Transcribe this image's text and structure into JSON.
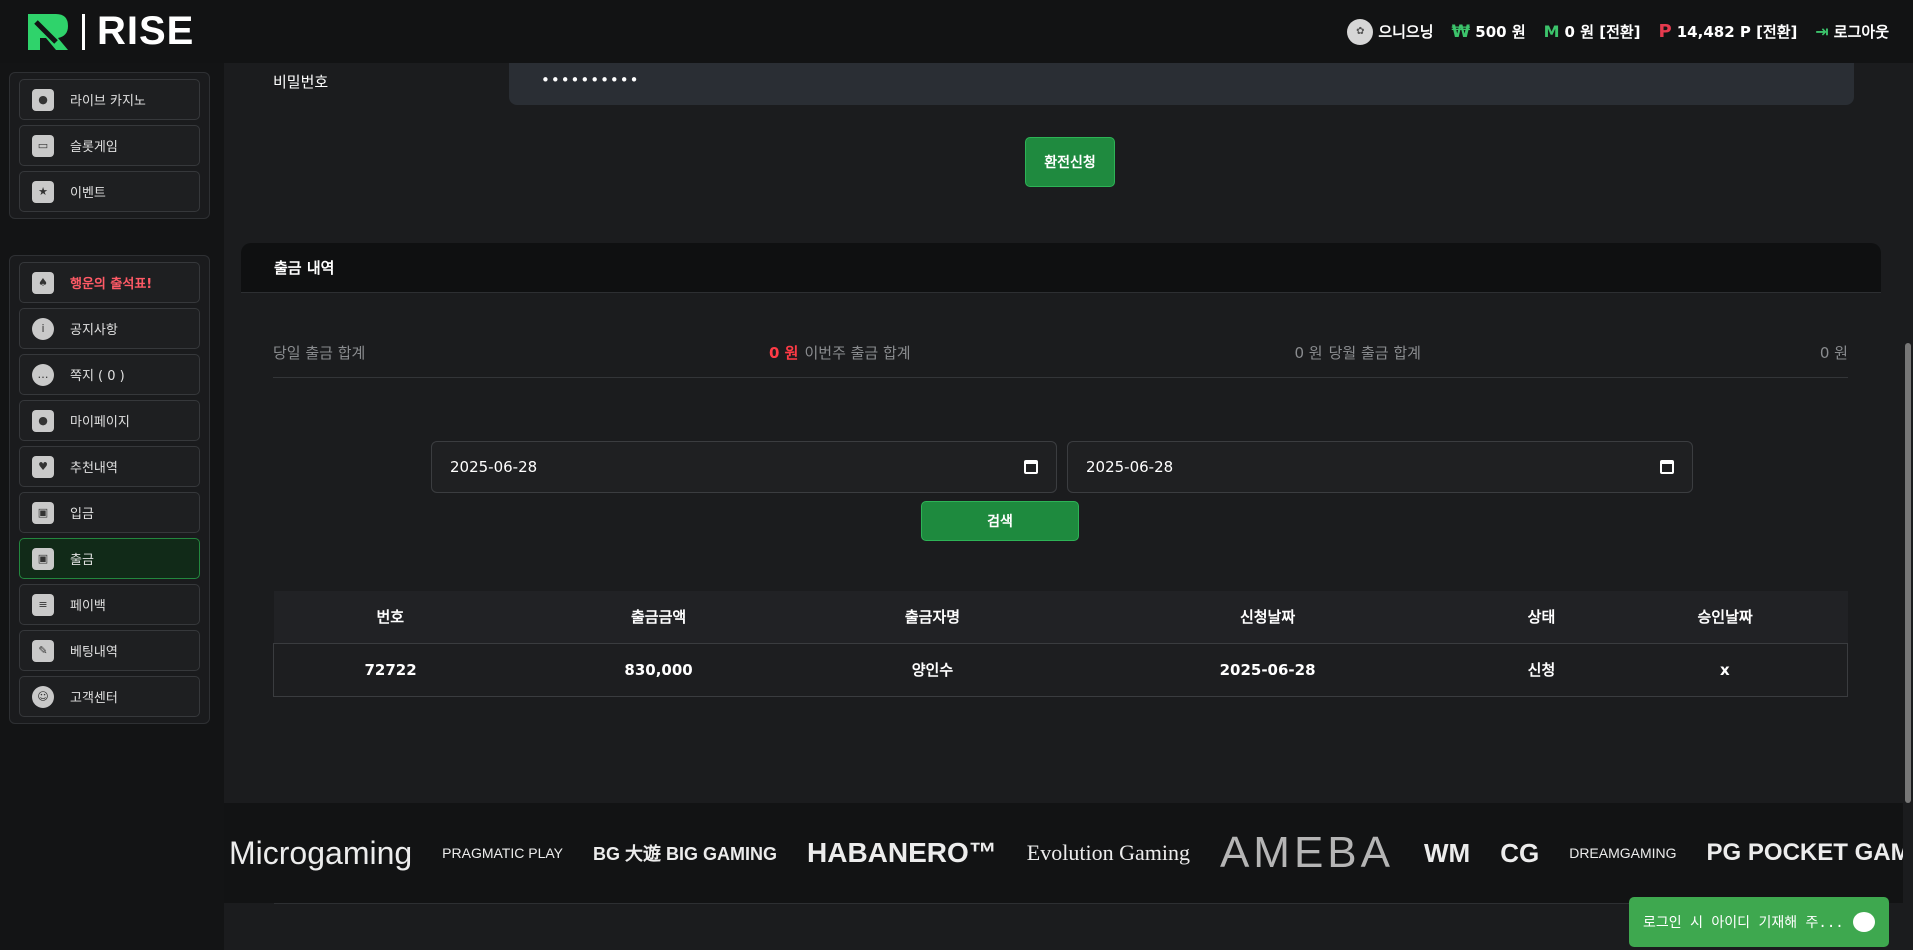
{
  "brand": {
    "name": "RISE"
  },
  "header": {
    "username": "으니으닝",
    "won_symbol": "₩",
    "balance": "500 원",
    "m_symbol": "M",
    "m_balance": "0 원 [전환]",
    "p_symbol": "P",
    "points": "14,482 P [전환]",
    "logout": "로그아웃"
  },
  "sidebar": {
    "group1": [
      {
        "label": "라이브 카지노",
        "icon": "casino-chips-icon"
      },
      {
        "label": "슬롯게임",
        "icon": "slot-machine-icon"
      },
      {
        "label": "이벤트",
        "icon": "star-badge-icon"
      }
    ],
    "group2": [
      {
        "label": "행운의 출석표!",
        "icon": "calendar-card-icon"
      },
      {
        "label": "공지사항",
        "icon": "info-icon"
      },
      {
        "label": "쪽지 ( 0 )",
        "icon": "message-icon"
      },
      {
        "label": "마이페이지",
        "icon": "user-icon"
      },
      {
        "label": "추천내역",
        "icon": "heart-icon"
      },
      {
        "label": "입금",
        "icon": "wallet-in-icon"
      },
      {
        "label": "출금",
        "icon": "wallet-out-icon"
      },
      {
        "label": "페이백",
        "icon": "coins-icon"
      },
      {
        "label": "베팅내역",
        "icon": "bet-list-icon"
      },
      {
        "label": "고객센터",
        "icon": "support-icon"
      }
    ]
  },
  "form": {
    "password_label": "비밀번호",
    "password_value": "••••••••••",
    "submit_label": "환전신청"
  },
  "history": {
    "title": "출금 내역",
    "today_label": "당일 출금 합계",
    "today_value": "0 원",
    "week_label": "이번주 출금 합계",
    "week_value": "0 원",
    "month_label": "당월 출금 합계",
    "month_value": "0 원",
    "date_from": "2025-06-28",
    "date_to": "2025-06-28",
    "search_label": "검색",
    "columns": [
      "번호",
      "출금금액",
      "출금자명",
      "신청날짜",
      "상태",
      "승인날짜"
    ],
    "rows": [
      [
        "72722",
        "830,000",
        "양인수",
        "2025-06-28",
        "신청",
        "x"
      ]
    ]
  },
  "providers": [
    "Microgaming",
    "PRAGMATIC PLAY",
    "BG 大遊 BIG GAMING",
    "HABANERO™",
    "Evolution Gaming",
    "AMEBA",
    "WM",
    "CG",
    "DREAMGAMING",
    "PG POCKET GAMES SOFT"
  ],
  "chat": {
    "text": "로그인 시 아이디 기재해 주..."
  }
}
